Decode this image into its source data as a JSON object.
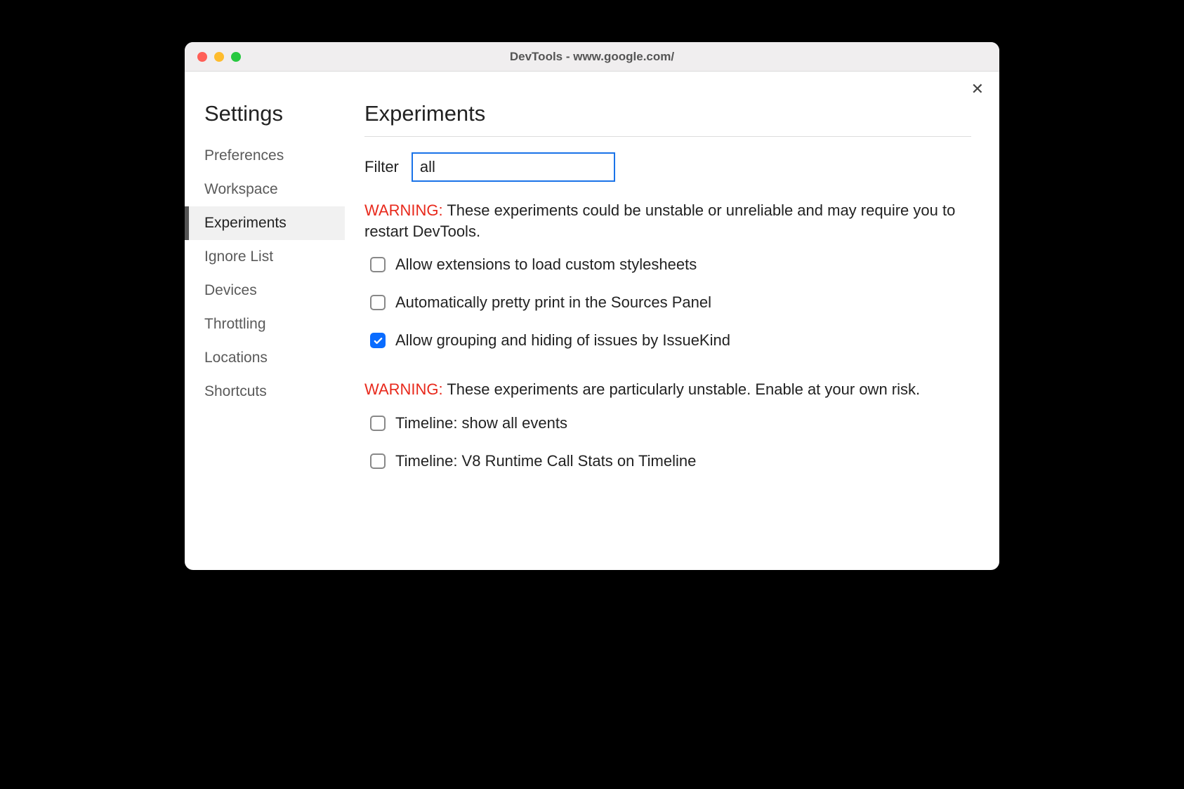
{
  "window": {
    "title": "DevTools - www.google.com/"
  },
  "sidebar": {
    "title": "Settings",
    "items": [
      {
        "label": "Preferences",
        "selected": false
      },
      {
        "label": "Workspace",
        "selected": false
      },
      {
        "label": "Experiments",
        "selected": true
      },
      {
        "label": "Ignore List",
        "selected": false
      },
      {
        "label": "Devices",
        "selected": false
      },
      {
        "label": "Throttling",
        "selected": false
      },
      {
        "label": "Locations",
        "selected": false
      },
      {
        "label": "Shortcuts",
        "selected": false
      }
    ]
  },
  "main": {
    "title": "Experiments",
    "filter": {
      "label": "Filter",
      "value": "all"
    },
    "warning1": {
      "prefix": "WARNING:",
      "text": " These experiments could be unstable or unreliable and may require you to restart DevTools."
    },
    "experiments1": [
      {
        "label": "Allow extensions to load custom stylesheets",
        "checked": false
      },
      {
        "label": "Automatically pretty print in the Sources Panel",
        "checked": false
      },
      {
        "label": "Allow grouping and hiding of issues by IssueKind",
        "checked": true
      }
    ],
    "warning2": {
      "prefix": "WARNING:",
      "text": " These experiments are particularly unstable. Enable at your own risk."
    },
    "experiments2": [
      {
        "label": "Timeline: show all events",
        "checked": false
      },
      {
        "label": "Timeline: V8 Runtime Call Stats on Timeline",
        "checked": false
      }
    ]
  }
}
